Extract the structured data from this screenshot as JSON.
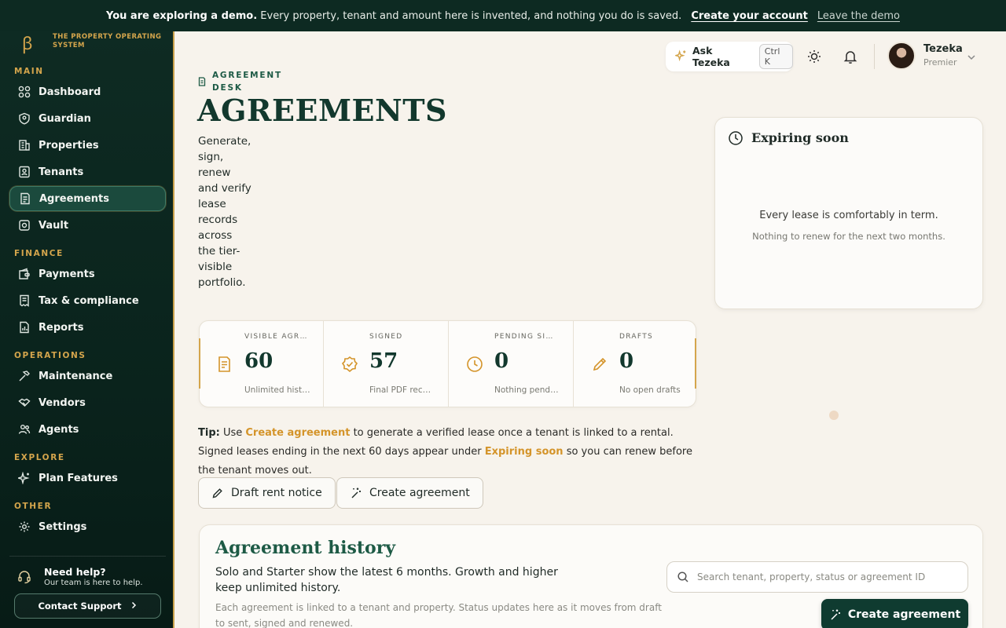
{
  "banner": {
    "strong": "You are exploring a demo.",
    "text": "Every property, tenant and amount here is invented, and nothing you do is saved.",
    "create_account": "Create your account",
    "leave_demo": "Leave the demo"
  },
  "brand": {
    "name": "THE PROPERTY OPERATING SYSTEM"
  },
  "sidebar": {
    "sections": {
      "main": "MAIN",
      "finance": "FINANCE",
      "operations": "OPERATIONS",
      "explore": "EXPLORE",
      "other": "OTHER"
    },
    "items": {
      "dashboard": "Dashboard",
      "guardian": "Guardian",
      "properties": "Properties",
      "tenants": "Tenants",
      "agreements": "Agreements",
      "vault": "Vault",
      "payments": "Payments",
      "tax": "Tax & compliance",
      "reports": "Reports",
      "maintenance": "Maintenance",
      "vendors": "Vendors",
      "agents": "Agents",
      "plan_features": "Plan Features",
      "settings": "Settings"
    },
    "active": "agreements",
    "help": {
      "title": "Need help?",
      "subtitle": "Our team is here to help.",
      "button": "Contact Support"
    }
  },
  "topbar": {
    "ask_label": "Ask Tezeka",
    "ask_shortcut": "Ctrl K",
    "user": {
      "name": "Tezeka",
      "role": "Premier"
    }
  },
  "page": {
    "eyebrow": "AGREEMENT DESK",
    "title": "AGREEMENTS",
    "subtitle": "Generate, sign, renew and verify lease records across the tier-visible portfolio."
  },
  "expiring": {
    "title": "Expiring soon",
    "message": "Every lease is comfortably in term.",
    "detail": "Nothing to renew for the next two months."
  },
  "stats": [
    {
      "label": "VISIBLE AGREEMENTS",
      "value": "60",
      "sub": "Unlimited history"
    },
    {
      "label": "SIGNED",
      "value": "57",
      "sub": "Final PDF records"
    },
    {
      "label": "PENDING SIGNATURE",
      "value": "0",
      "sub": "Nothing pending"
    },
    {
      "label": "DRAFTS",
      "value": "0",
      "sub": "No open drafts"
    }
  ],
  "tip": {
    "label": "Tip:",
    "p1": " Use ",
    "link1": "Create agreement",
    "p2": " to generate a verified lease once a tenant is linked to a rental. Signed leases ending in the next 60 days appear under ",
    "link2": "Expiring soon",
    "p3": " so you can renew before the tenant moves out."
  },
  "actions": {
    "draft_notice": "Draft rent notice",
    "create_agreement": "Create agreement"
  },
  "history": {
    "title": "Agreement history",
    "desc1": "Solo and Starter show the latest 6 months. Growth and higher keep unlimited history.",
    "desc2": "Each agreement is linked to a tenant and property. Status updates here as it moves from draft to sent, signed and renewed.",
    "search_placeholder": "Search tenant, property, status or agreement ID",
    "primary_button": "Create agreement"
  },
  "colors": {
    "sidebar": "#0e2b23",
    "accent": "#d4a54c",
    "primary": "#0f3b30",
    "highlight": "#d4942a"
  }
}
